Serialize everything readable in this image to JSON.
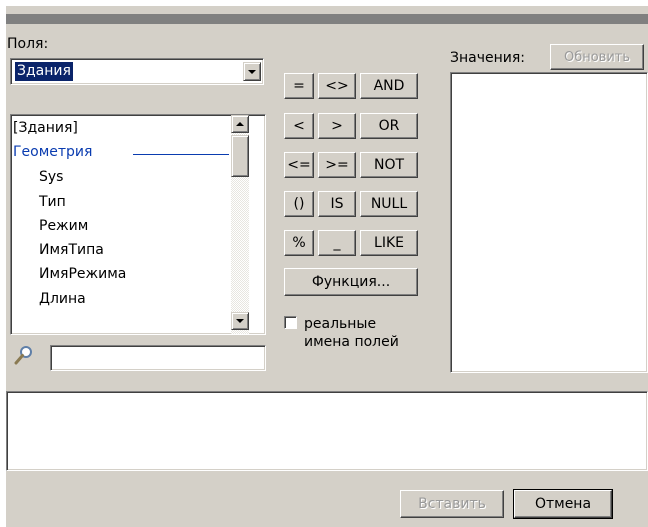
{
  "fields": {
    "label": "Поля:",
    "table_combo_value": "Здания",
    "list_items": [
      {
        "text": "[Здания]",
        "kind": "table"
      },
      {
        "text": "Геометрия",
        "kind": "group"
      },
      {
        "text": "Sys",
        "kind": "field"
      },
      {
        "text": "Тип",
        "kind": "field"
      },
      {
        "text": "Режим",
        "kind": "field"
      },
      {
        "text": "ИмяТипа",
        "kind": "field"
      },
      {
        "text": "ИмяРежима",
        "kind": "field"
      },
      {
        "text": "Длина",
        "kind": "field"
      }
    ],
    "search_value": ""
  },
  "operators": {
    "eq": "=",
    "neq": "<>",
    "and": "AND",
    "lt": "<",
    "gt": ">",
    "or": "OR",
    "le": "<=",
    "ge": ">=",
    "not": "NOT",
    "paren": "()",
    "is": "IS",
    "null": "NULL",
    "percent": "%",
    "underscore": "_",
    "like": "LIKE",
    "function": "Функция..."
  },
  "real_names": {
    "checked": false,
    "line1": "реальные",
    "line2": "имена полей"
  },
  "values": {
    "label": "Значения:",
    "refresh_label": "Обновить"
  },
  "expression_value": "",
  "footer": {
    "insert_label": "Вставить",
    "cancel_label": "Отмена"
  },
  "colors": {
    "dialog_bg": "#d4d0c8",
    "selection_bg": "#0a246a",
    "group_text": "#0a3cb0"
  }
}
